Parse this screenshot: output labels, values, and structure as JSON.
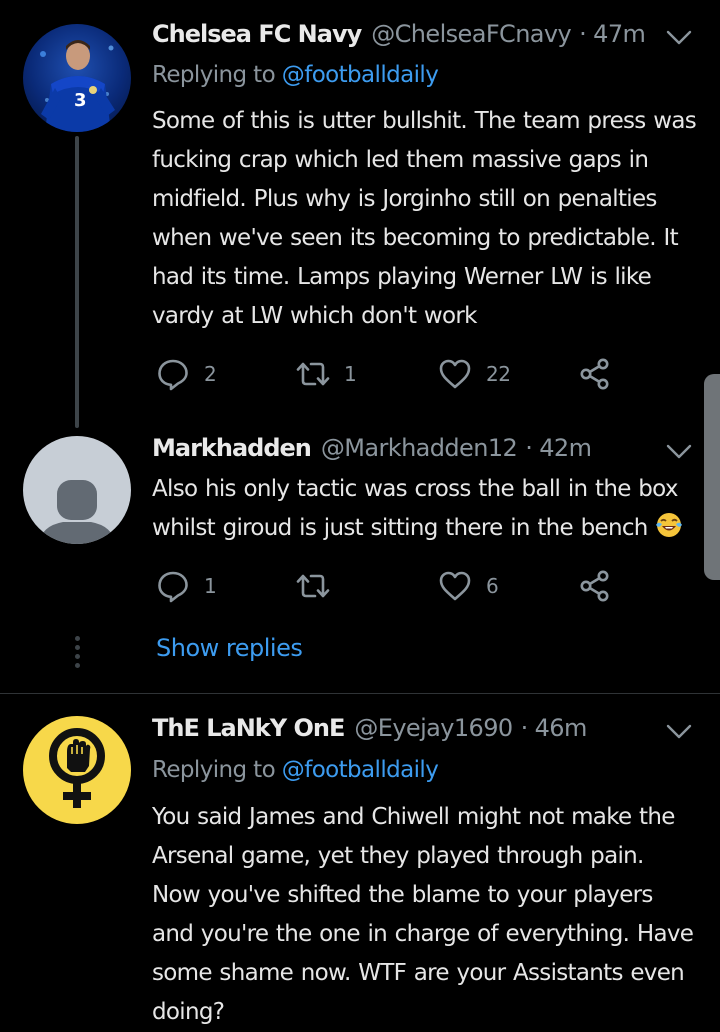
{
  "colors": {
    "background": "#000000",
    "link": "#3d9cf0",
    "muted": "#8b959d",
    "text": "#e6e6e6"
  },
  "tweets": [
    {
      "display_name": "Chelsea FC Navy",
      "handle": "@ChelseaFCnavy",
      "time": "· 47m",
      "replying_prefix": "Replying to",
      "replying_to": "@footballdaily",
      "text": "Some of this is utter bullshit. The team press was fucking crap which led them massive gaps in midfield. Plus why is Jorginho still on penalties when we've seen its becoming to predictable. It had its time. Lamps playing Werner LW is like vardy at LW which don't work",
      "replies": "2",
      "retweets": "1",
      "likes": "22",
      "avatar_icon": "player-photo-avatar"
    },
    {
      "display_name": "Markhadden",
      "handle": "@Markhadden12",
      "time": "· 42m",
      "text": "Also his only tactic was cross the ball in the box whilst giroud is just sitting there in the bench",
      "emoji_icon": "tears-of-joy-emoji",
      "replies": "1",
      "retweets": "",
      "likes": "6",
      "avatar_icon": "default-person-avatar"
    },
    {
      "display_name": "ThE LaNkY OnE",
      "handle": "@Eyejay1690",
      "time": "· 46m",
      "replying_prefix": "Replying to",
      "replying_to": "@footballdaily",
      "text": "You said James and Chiwell might not make the Arsenal game, yet they played through pain. Now you've shifted the blame to your players and you're the one in charge of everything. Have some shame now. WTF are your Assistants even doing?",
      "avatar_icon": "fist-venus-symbol-avatar"
    }
  ],
  "show_replies": "Show replies"
}
